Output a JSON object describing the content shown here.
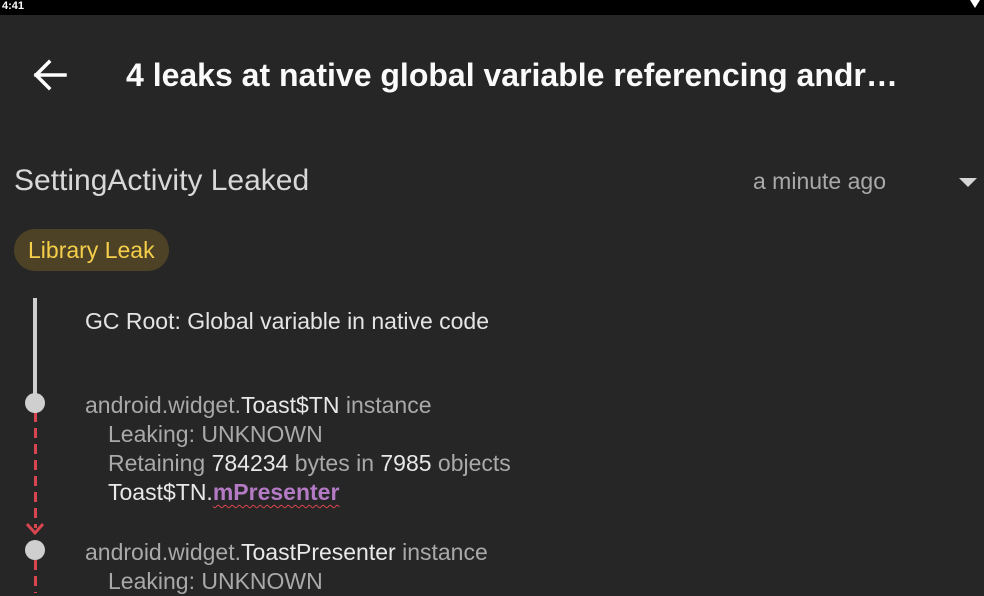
{
  "status_bar": {
    "time": "4:41"
  },
  "app_bar": {
    "back_icon": "arrow-back-icon",
    "title": "4 leaks at native global variable referencing andr…"
  },
  "leak_header": {
    "title": "SettingActivity Leaked",
    "time_ago": "a minute ago",
    "expand_icon": "dropdown-arrow-icon"
  },
  "badge": {
    "label": "Library Leak",
    "text_color": "#f6cf4a",
    "background": "#4d4226"
  },
  "colors": {
    "background": "#262626",
    "leak_line": "#d8454e",
    "reference_field": "#b47ac4"
  },
  "trace": {
    "gc_root": "GC Root: Global variable in native code",
    "items": [
      {
        "package": "android.widget.",
        "class_name": "Toast$TN",
        "suffix": " instance",
        "leaking": "Leaking: UNKNOWN",
        "retaining_prefix": "Retaining ",
        "retaining_bytes": "784234",
        "retaining_mid": " bytes in ",
        "retaining_objects": "7985",
        "retaining_suffix": " objects",
        "ref_owner": "Toast$TN.",
        "ref_field": "mPresenter"
      },
      {
        "package": "android.widget.",
        "class_name": "ToastPresenter",
        "suffix": " instance",
        "leaking": "Leaking: UNKNOWN"
      }
    ]
  }
}
